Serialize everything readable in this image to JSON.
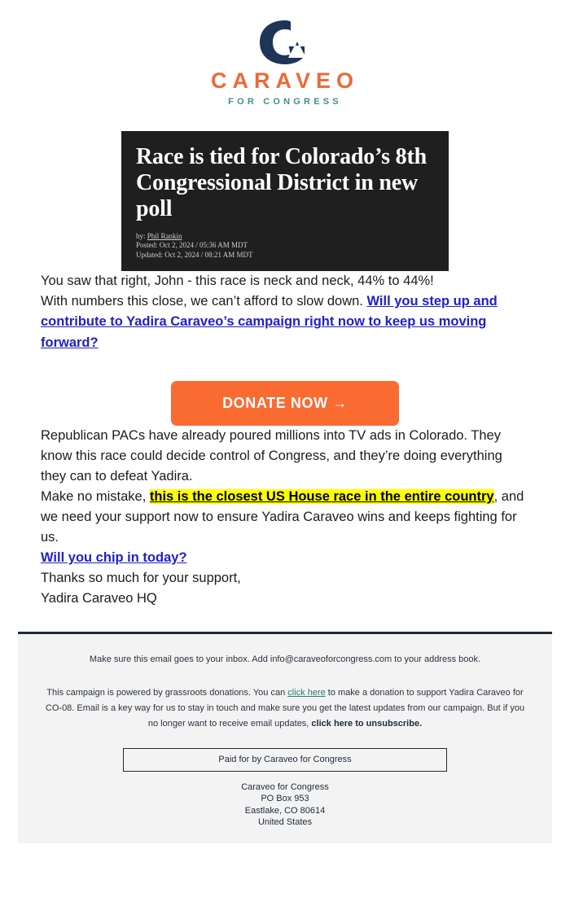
{
  "brand": {
    "logo_icon": "colorado-c-mountain-logo",
    "wordmark": "CARAVEO",
    "tagline": "FOR CONGRESS",
    "orange": "#ef6838",
    "teal": "#3f8f8a",
    "navy": "#1d2b3a"
  },
  "article_card": {
    "headline": "Race is tied for Colorado’s 8th Congressional District in new poll",
    "byline_prefix": "by:",
    "byline_author": "Phil Rankin",
    "posted": "Posted: Oct 2, 2024 / 05:36 AM MDT",
    "updated": "Updated: Oct 2, 2024 / 08:21 AM MDT"
  },
  "body": {
    "p1": "You saw that right, John - this race is neck and neck, 44% to 44%!",
    "p2_lead": "With numbers this close, we can’t afford to slow down. ",
    "p2_link": "Will you step up and contribute to Yadira Caraveo’s campaign right now to keep us moving forward?",
    "p3": "Republican PACs have already poured millions into TV ads in Colorado. They know this race could decide control of Congress, and they’re doing everything they can to defeat Yadira.",
    "p4_lead": "Make no mistake, ",
    "p4_highlight": "this is the closest US House race in the entire country",
    "p4_tail": ", and we need your support now to ensure Yadira Caraveo wins and keeps fighting for us.",
    "p5_link": "Will you chip in today?",
    "p6": "Thanks so much for your support,",
    "p7": "Yadira Caraveo HQ"
  },
  "cta": {
    "label": "DONATE NOW →",
    "color": "#fa6b32"
  },
  "footer": {
    "inbox_note": "Make sure this email goes to your inbox. Add info@caraveoforcongress.com to your address book.",
    "para_a": "This campaign is powered by grassroots donations. You can ",
    "link_click_here": "click here",
    "para_b": " to make a donation to support Yadira Caraveo for CO-08. Email is a key way for us to stay in touch and make sure you get the latest updates from our campaign. But if you no longer want to receive email updates, ",
    "unsubscribe": "click here to unsubscribe.",
    "paid_for": "Paid for by Caraveo for Congress",
    "address_line1": "Caraveo for Congress",
    "address_line2": "PO Box 953",
    "address_line3": "Eastlake, CO 80614",
    "address_line4": "United States"
  }
}
